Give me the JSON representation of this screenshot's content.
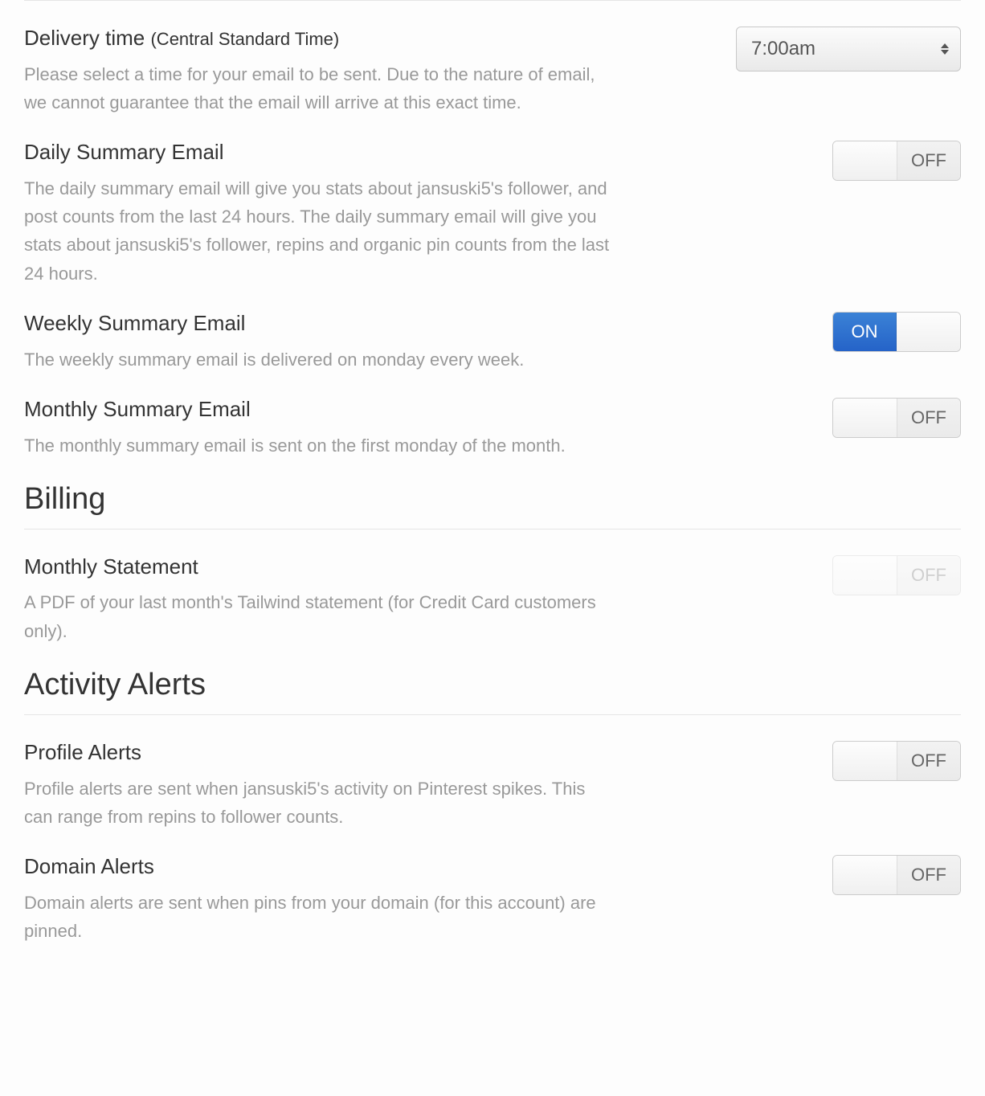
{
  "delivery_time": {
    "title": "Delivery time",
    "note": "(Central Standard Time)",
    "description": "Please select a time for your email to be sent. Due to the nature of email, we cannot guarantee that the email will arrive at this exact time.",
    "value": "7:00am"
  },
  "daily_summary": {
    "title": "Daily Summary Email",
    "description": "The daily summary email will give you stats about jansuski5's follower, and post counts from the last 24 hours. The daily summary email will give you stats about jansuski5's follower, repins and organic pin counts from the last 24 hours.",
    "state": "OFF"
  },
  "weekly_summary": {
    "title": "Weekly Summary Email",
    "description": "The weekly summary email is delivered on monday every week.",
    "state": "ON"
  },
  "monthly_summary": {
    "title": "Monthly Summary Email",
    "description": "The monthly summary email is sent on the first monday of the month.",
    "state": "OFF"
  },
  "sections": {
    "billing": "Billing",
    "activity_alerts": "Activity Alerts"
  },
  "monthly_statement": {
    "title": "Monthly Statement",
    "description": "A PDF of your last month's Tailwind statement (for Credit Card customers only).",
    "state": "OFF"
  },
  "profile_alerts": {
    "title": "Profile Alerts",
    "description": "Profile alerts are sent when jansuski5's activity on Pinterest spikes. This can range from repins to follower counts.",
    "state": "OFF"
  },
  "domain_alerts": {
    "title": "Domain Alerts",
    "description": "Domain alerts are sent when pins from your domain (for this account) are pinned.",
    "state": "OFF"
  }
}
